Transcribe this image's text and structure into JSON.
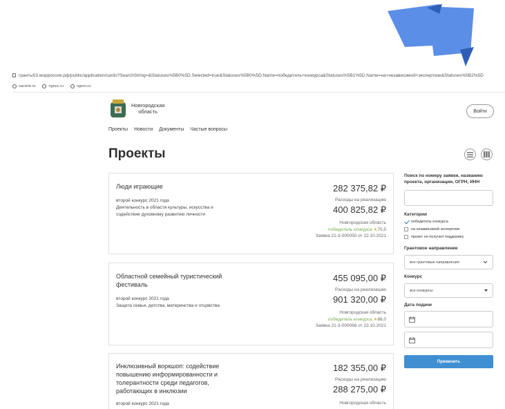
{
  "browser": {
    "url": "гранты53.морроссия.рф/public/application/cards?SearchString=&Statuses%5B0%5D.Selected=true&Statuses%5B0%5D.Name=победитель+конкурса&Statuses%5B1%5D.Name=на+независимой+экспертизе&Statuses%5B2%5D",
    "bookmarks": [
      "oacentr.ru",
      "ngnoc.ru",
      "ognov.ru"
    ]
  },
  "header": {
    "logo_line1": "Новгородская",
    "logo_line2": "область",
    "login": "Войти"
  },
  "nav": [
    "Проекты",
    "Новости",
    "Документы",
    "Частые вопросы"
  ],
  "page": {
    "title": "Проекты"
  },
  "cards": [
    {
      "title": "Люди играющие",
      "contest": "второй конкурс 2021 года",
      "direction": "Деятельность в области культуры, искусства и содействие духовному развитию личности",
      "grant": "282 375,82 ₽",
      "expenses_label": "Расходы на реализацию",
      "expenses": "400 825,82 ₽",
      "region": "Новгородская область",
      "status": "победитель конкурса",
      "score": "75,5",
      "application": "Заявка 21-3-000050 от 22.10.2021"
    },
    {
      "title": "Областной семейный туристический фестиваль",
      "contest": "второй конкурс 2021 года",
      "direction": "Защита семьи, детства, материнства и отцовства",
      "grant": "455 095,00 ₽",
      "expenses_label": "Расходы на реализацию",
      "expenses": "901 320,00 ₽",
      "region": "Новгородская область",
      "status": "победитель конкурса",
      "score": "86,0",
      "application": "Заявка 21-3-000066 от 22.10.2021"
    },
    {
      "title": "Инклюзивный воркшоп: содействие повышению информированности и толерантности среди педагогов, работающих в инклюзии",
      "contest": "второй конкурс 2021 года",
      "grant": "182 355,00 ₽",
      "expenses_label": "Расходы на реализацию",
      "expenses": "288 275,00 ₽",
      "region": "Новгородская область"
    }
  ],
  "sidebar": {
    "search_label": "Поиск по номеру заявки, названию проекта, организации, ОГРН, ИНН",
    "categories_label": "Категории",
    "categories": [
      {
        "label": "победитель конкурса",
        "checked": true
      },
      {
        "label": "на независимой экспертизе",
        "checked": false
      },
      {
        "label": "проект не получил поддержку",
        "checked": false
      }
    ],
    "direction_label": "Грантовое направление",
    "direction_value": "все грантовые направления",
    "contest_label": "Конкурс",
    "contest_value": "все конкурсы",
    "date_label": "Дата подачи",
    "apply": "Применить"
  },
  "colors": {
    "accent": "#3f8fd2",
    "status_green": "#7aa850",
    "ribbon": "#5b8ee6"
  }
}
